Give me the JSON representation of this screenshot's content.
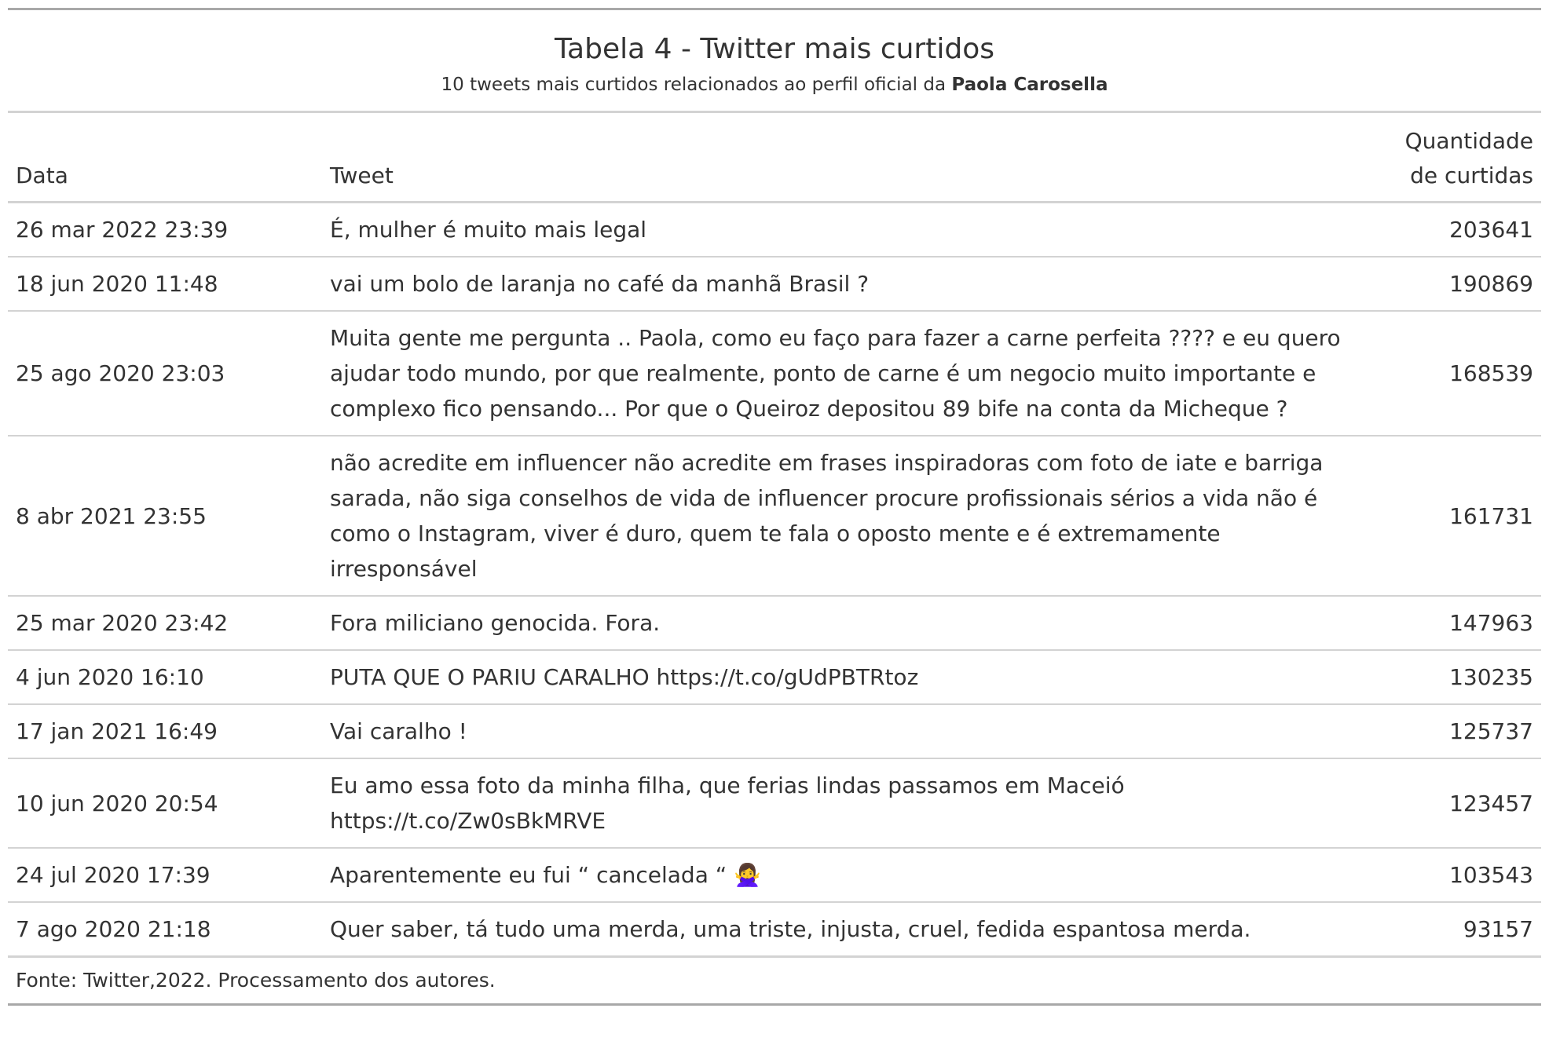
{
  "header": {
    "title": "Tabela 4 - Twitter mais curtidos",
    "subtitle_prefix": "10 tweets mais curtidos relacionados ao perfil oficial da ",
    "subtitle_bold": "Paola Carosella"
  },
  "table": {
    "columns": {
      "date": "Data",
      "tweet": "Tweet",
      "likes_line1": "Quantidade",
      "likes_line2": "de curtidas"
    },
    "rows": [
      {
        "date": "26 mar 2022 23:39",
        "tweet": "É, mulher é muito mais legal",
        "likes": "203641"
      },
      {
        "date": "18 jun 2020 11:48",
        "tweet": "vai um bolo de laranja no café da manhã Brasil ?",
        "likes": "190869"
      },
      {
        "date": "25 ago 2020 23:03",
        "tweet": "Muita gente me pergunta .. Paola, como eu faço para fazer a carne perfeita ???? e eu quero ajudar todo mundo, por que realmente, ponto de carne é um negocio muito importante e complexo fico pensando... Por que o Queiroz depositou 89 bife na conta da Micheque ?",
        "likes": "168539"
      },
      {
        "date": "8 abr 2021 23:55",
        "tweet": "não acredite em influencer não acredite em frases inspiradoras com foto de iate e barriga sarada, não siga conselhos de vida de influencer procure profissionais sérios a vida não é como o Instagram, viver é duro, quem te fala o oposto mente e é extremamente irresponsável",
        "likes": "161731"
      },
      {
        "date": "25 mar 2020 23:42",
        "tweet": "Fora miliciano genocida. Fora.",
        "likes": "147963"
      },
      {
        "date": "4 jun 2020 16:10",
        "tweet": "PUTA QUE O PARIU CARALHO https://t.co/gUdPBTRtoz",
        "likes": "130235"
      },
      {
        "date": "17 jan 2021 16:49",
        "tweet": "Vai caralho !",
        "likes": "125737"
      },
      {
        "date": "10 jun 2020 20:54",
        "tweet": "Eu amo essa foto da minha filha, que ferias lindas passamos em Maceió https://t.co/Zw0sBkMRVE",
        "likes": "123457"
      },
      {
        "date": "24 jul 2020 17:39",
        "tweet": "Aparentemente eu fui “ cancelada “ 🙅‍♀",
        "likes": "103543"
      },
      {
        "date": "7 ago 2020 21:18",
        "tweet": "Quer saber, tá tudo uma merda, uma triste, injusta, cruel, fedida espantosa merda.",
        "likes": "93157"
      }
    ]
  },
  "footer": {
    "source": "Fonte: Twitter,2022. Processamento dos autores."
  }
}
